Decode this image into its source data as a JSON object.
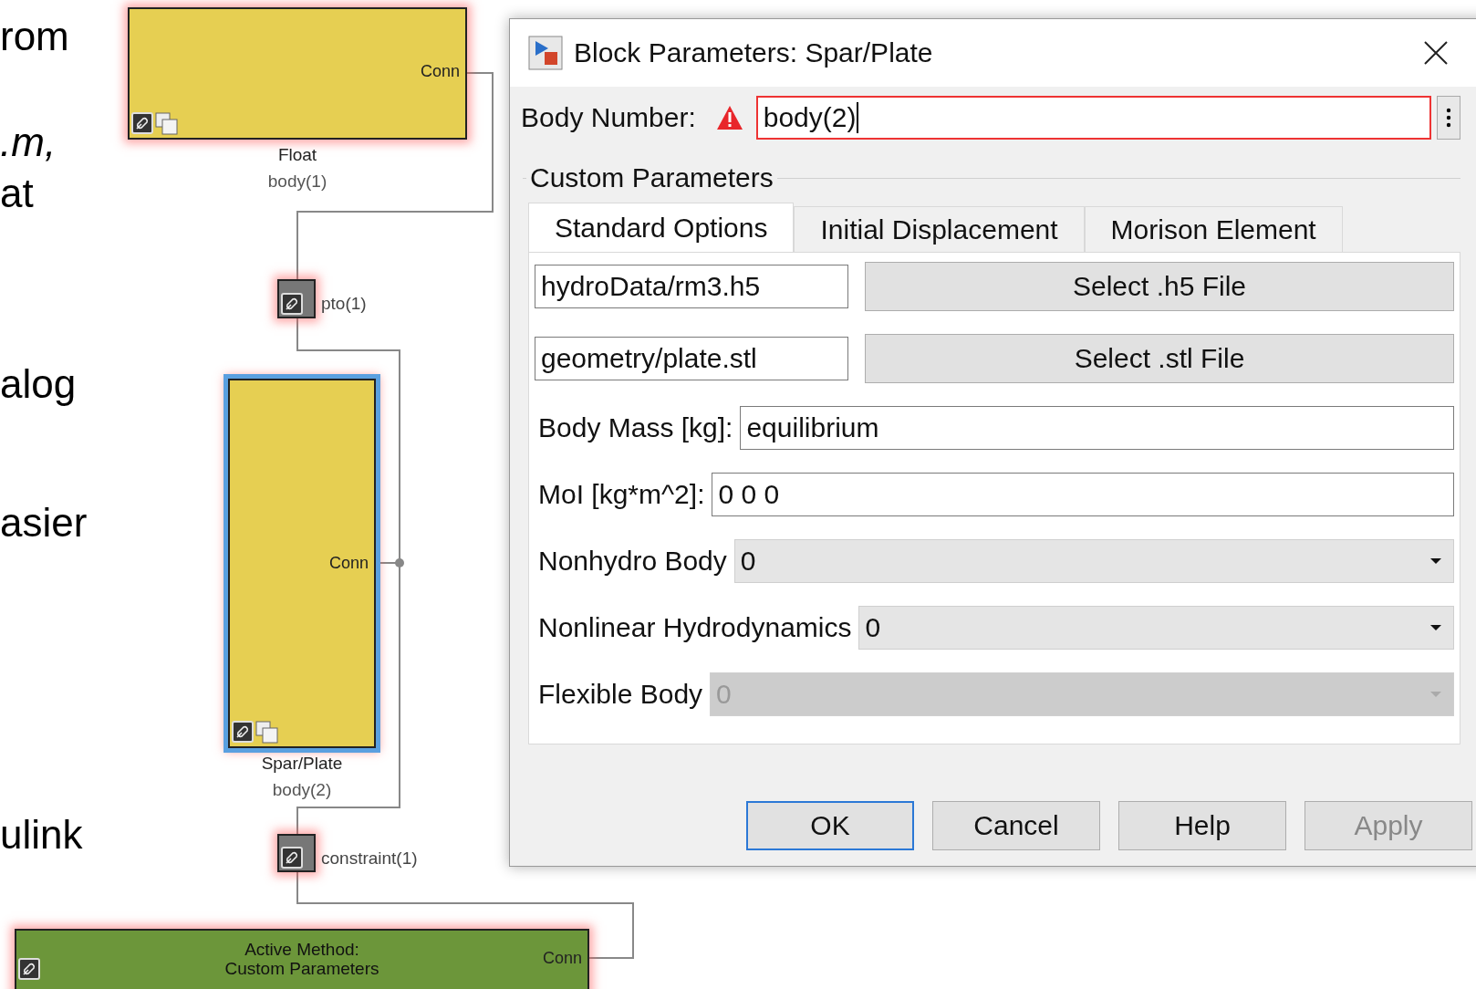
{
  "slide_text": [
    {
      "text": "rom",
      "italic": false
    },
    {
      "text": ".m,",
      "italic": true
    },
    {
      "text": "at",
      "italic": false
    },
    {
      "text": "alog",
      "italic": false
    },
    {
      "text": "asier",
      "italic": false
    },
    {
      "text": "ulink",
      "italic": false
    }
  ],
  "diagram": {
    "blocks": [
      {
        "kind": "body",
        "name": "Float",
        "label": "body(1)",
        "port": "Conn",
        "selected": false
      },
      {
        "kind": "pto",
        "label": "pto(1)"
      },
      {
        "kind": "body",
        "name": "Spar/Plate",
        "label": "body(2)",
        "port": "Conn",
        "selected": true
      },
      {
        "kind": "constraint",
        "label": "constraint(1)"
      },
      {
        "kind": "method",
        "lines": [
          "Active Method:",
          "Custom Parameters"
        ],
        "port": "Conn"
      }
    ]
  },
  "dialog": {
    "title": "Block Parameters: Spar/Plate",
    "body_number": {
      "label": "Body Number:",
      "value": "body(2)",
      "error": true
    },
    "group_label": "Custom Parameters",
    "tabs": [
      {
        "label": "Standard Options",
        "selected": true
      },
      {
        "label": "Initial Displacement",
        "selected": false
      },
      {
        "label": "Morison Element",
        "selected": false
      }
    ],
    "file_rows": [
      {
        "value": "hydroData/rm3.h5",
        "button": "Select .h5 File"
      },
      {
        "value": "geometry/plate.stl",
        "button": "Select .stl File"
      }
    ],
    "params": [
      {
        "kind": "text",
        "label": "Body Mass [kg]:",
        "value": "equilibrium"
      },
      {
        "kind": "text",
        "label": "MoI [kg*m^2]:",
        "value": "0 0 0"
      },
      {
        "kind": "dropdown",
        "label": "Nonhydro Body",
        "value": "0",
        "disabled": false
      },
      {
        "kind": "dropdown",
        "label": "Nonlinear Hydrodynamics",
        "value": "0",
        "disabled": false
      },
      {
        "kind": "dropdown",
        "label": "Flexible Body",
        "value": "0",
        "disabled": true
      }
    ],
    "buttons": [
      {
        "label": "OK",
        "default": true,
        "disabled": false
      },
      {
        "label": "Cancel",
        "default": false,
        "disabled": false
      },
      {
        "label": "Help",
        "default": false,
        "disabled": false
      },
      {
        "label": "Apply",
        "default": false,
        "disabled": true
      }
    ]
  }
}
